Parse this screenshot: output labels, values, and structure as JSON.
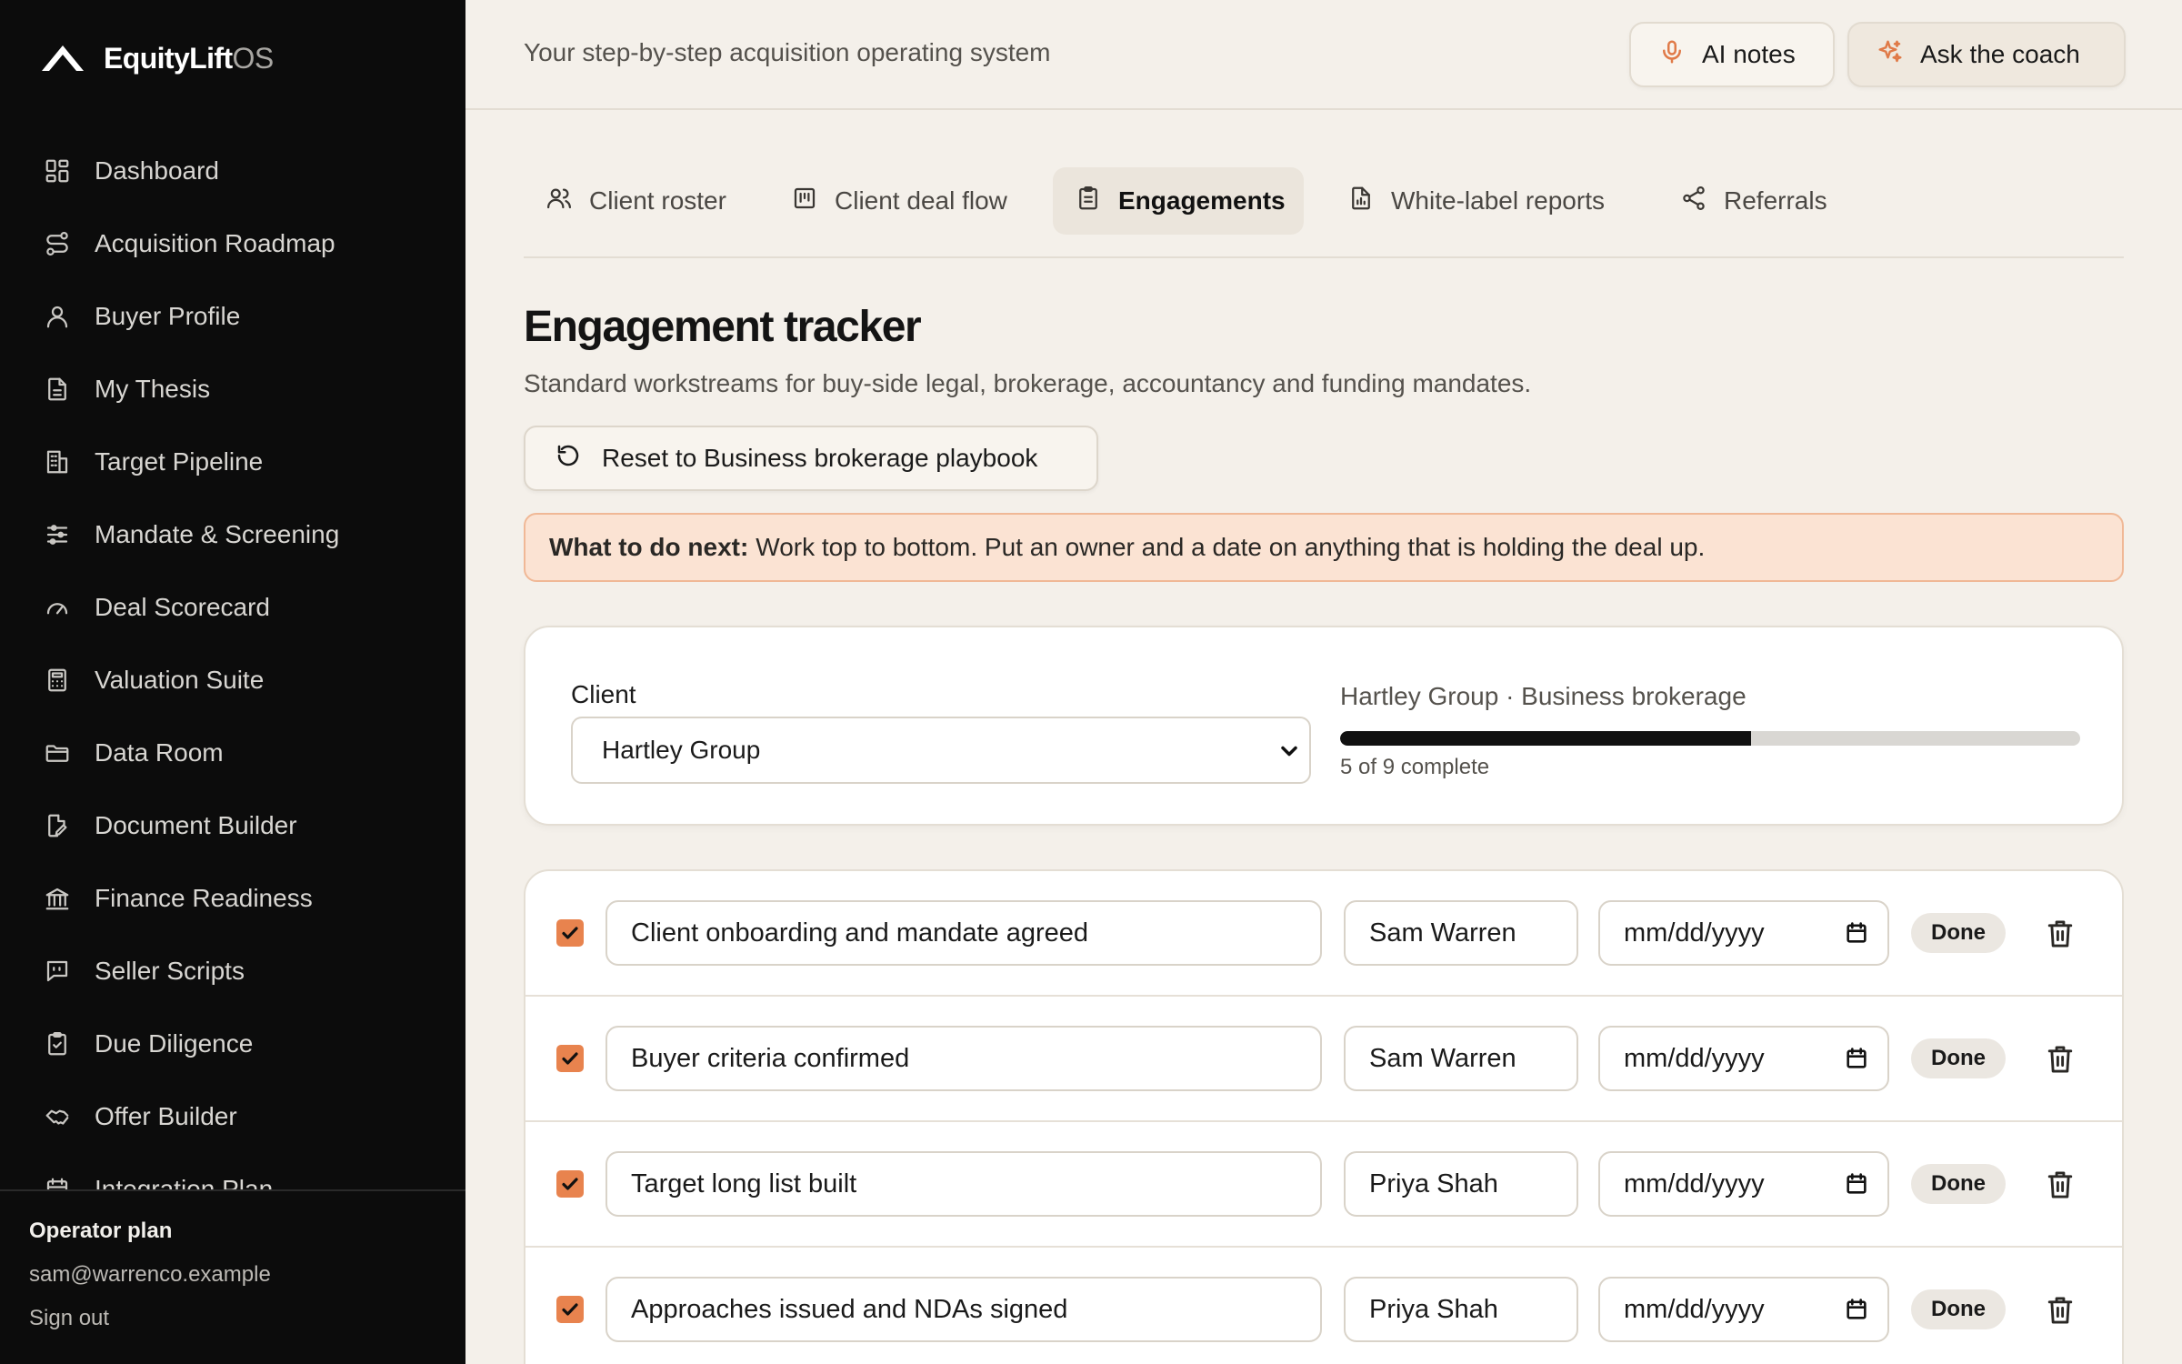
{
  "brand": {
    "name": "EquityLift",
    "suffix": "OS",
    "logo_icon": "logo-mark-icon"
  },
  "sidebar": {
    "items": [
      {
        "label": "Dashboard",
        "icon": "dashboard-icon"
      },
      {
        "label": "Acquisition Roadmap",
        "icon": "route-icon"
      },
      {
        "label": "Buyer Profile",
        "icon": "user-icon"
      },
      {
        "label": "My Thesis",
        "icon": "document-icon"
      },
      {
        "label": "Target Pipeline",
        "icon": "building-icon"
      },
      {
        "label": "Mandate & Screening",
        "icon": "sliders-icon"
      },
      {
        "label": "Deal Scorecard",
        "icon": "gauge-icon"
      },
      {
        "label": "Valuation Suite",
        "icon": "calculator-icon"
      },
      {
        "label": "Data Room",
        "icon": "folder-icon"
      },
      {
        "label": "Document Builder",
        "icon": "file-edit-icon"
      },
      {
        "label": "Finance Readiness",
        "icon": "bank-icon"
      },
      {
        "label": "Seller Scripts",
        "icon": "chat-icon"
      },
      {
        "label": "Due Diligence",
        "icon": "clipboard-check-icon"
      },
      {
        "label": "Offer Builder",
        "icon": "handshake-icon"
      },
      {
        "label": "Integration Plan",
        "icon": "calendar-icon"
      }
    ],
    "footer": {
      "plan": "Operator plan",
      "email": "sam@warrenco.example",
      "sign_out": "Sign out"
    }
  },
  "topbar": {
    "tagline": "Your step-by-step acquisition operating system",
    "ai_notes": "AI notes",
    "ask_coach": "Ask the coach"
  },
  "tabs": [
    {
      "label": "Client roster",
      "icon": "users-icon",
      "active": false
    },
    {
      "label": "Client deal flow",
      "icon": "kanban-icon",
      "active": false
    },
    {
      "label": "Engagements",
      "icon": "clipboard-icon",
      "active": true
    },
    {
      "label": "White-label reports",
      "icon": "report-icon",
      "active": false
    },
    {
      "label": "Referrals",
      "icon": "share-icon",
      "active": false
    }
  ],
  "page": {
    "title": "Engagement tracker",
    "subtitle": "Standard workstreams for buy-side legal, brokerage, accountancy and funding mandates.",
    "reset_button": "Reset to Business brokerage playbook",
    "callout_label": "What to do next:",
    "callout_text": "Work top to bottom. Put an owner and a date on anything that is holding the deal up."
  },
  "client": {
    "label": "Client",
    "selected": "Hartley Group",
    "info": "Hartley Group · Business brokerage",
    "progress_done": 5,
    "progress_total": 9,
    "progress_text": "5 of 9 complete"
  },
  "tasks": [
    {
      "name": "Client onboarding and mandate agreed",
      "owner": "Sam Warren",
      "date": "mm/dd/yyyy",
      "status": "Done",
      "checked": true
    },
    {
      "name": "Buyer criteria confirmed",
      "owner": "Sam Warren",
      "date": "mm/dd/yyyy",
      "status": "Done",
      "checked": true
    },
    {
      "name": "Target long list built",
      "owner": "Priya Shah",
      "date": "mm/dd/yyyy",
      "status": "Done",
      "checked": true
    },
    {
      "name": "Approaches issued and NDAs signed",
      "owner": "Priya Shah",
      "date": "mm/dd/yyyy",
      "status": "Done",
      "checked": true
    }
  ],
  "colors": {
    "accent": "#e8834e",
    "sidebar_bg": "#0c0c0c",
    "page_bg": "#f4f0ea",
    "callout_bg": "#fbe3d3"
  }
}
